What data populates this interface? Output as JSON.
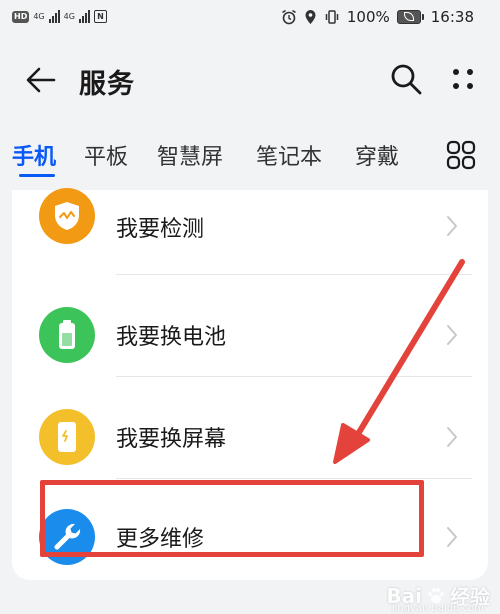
{
  "status_bar": {
    "hd_label": "HD",
    "net_1": "4G",
    "net_2": "4G",
    "nfc": "N",
    "battery_percent": "100%",
    "time": "16:38"
  },
  "header": {
    "title": "服务"
  },
  "tabs": [
    {
      "label": "手机",
      "active": true
    },
    {
      "label": "平板",
      "active": false
    },
    {
      "label": "智慧屏",
      "active": false
    },
    {
      "label": "笔记本",
      "active": false
    },
    {
      "label": "穿戴",
      "active": false
    }
  ],
  "items": [
    {
      "label": "我要检测",
      "icon": "shield-check-icon",
      "color": "#f29a13"
    },
    {
      "label": "我要换电池",
      "icon": "battery-icon",
      "color": "#3cc35a"
    },
    {
      "label": "我要换屏幕",
      "icon": "phone-screen-icon",
      "color": "#f3c02c"
    },
    {
      "label": "更多维修",
      "icon": "wrench-icon",
      "color": "#1a8cec"
    }
  ],
  "annotation": {
    "color": "#e3433a",
    "highlighted_item": "更多维修"
  },
  "watermark": {
    "brand": "Bai",
    "brand_suffix": "经验",
    "sub": "jingyan.baidu.com"
  },
  "colors": {
    "accent": "#0a59f7",
    "background": "#f1f3f5"
  }
}
